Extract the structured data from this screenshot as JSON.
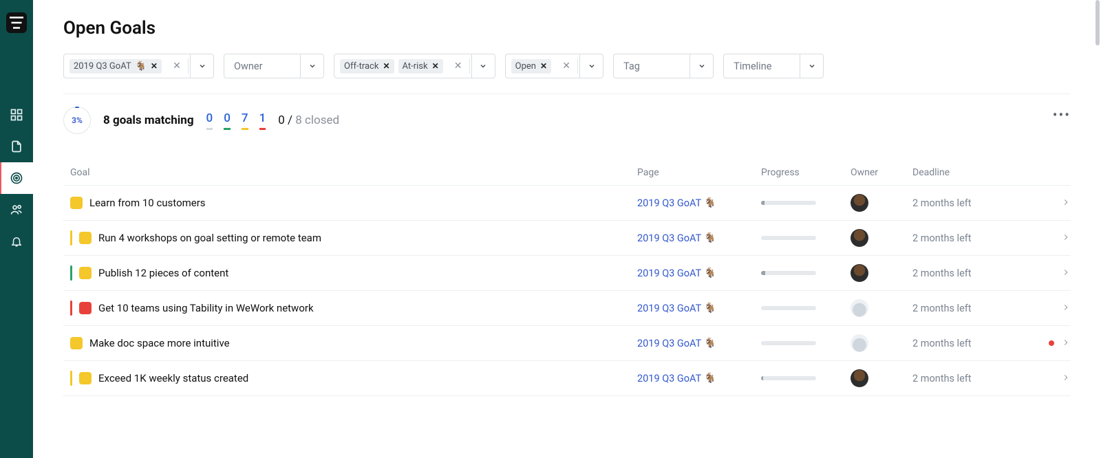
{
  "page": {
    "title": "Open Goals"
  },
  "sidebar": {
    "items": [
      {
        "name": "dashboard-icon"
      },
      {
        "name": "document-icon"
      },
      {
        "name": "target-icon",
        "active": true
      },
      {
        "name": "people-icon"
      },
      {
        "name": "bell-icon"
      }
    ]
  },
  "filters": {
    "goat": {
      "chips": [
        {
          "label": "2019 Q3 GoAT",
          "emoji": "🐐"
        }
      ]
    },
    "owner": {
      "placeholder": "Owner"
    },
    "health": {
      "chips": [
        {
          "label": "Off-track"
        },
        {
          "label": "At-risk"
        }
      ]
    },
    "status": {
      "chips": [
        {
          "label": "Open"
        }
      ]
    },
    "tag": {
      "placeholder": "Tag"
    },
    "timeline": {
      "placeholder": "Timeline"
    }
  },
  "summary": {
    "pct": "3%",
    "match_label": "8 goals matching",
    "counts": {
      "none": "0",
      "green": "0",
      "yellow": "7",
      "red": "1",
      "open_closed_prefix": "0",
      "open_closed_sep": " / ",
      "closed": "8 closed"
    }
  },
  "columns": {
    "goal": "Goal",
    "page": "Page",
    "progress": "Progress",
    "owner": "Owner",
    "deadline": "Deadline"
  },
  "page_ref": {
    "label": "2019 Q3 GoAT",
    "emoji": "🐐"
  },
  "rows": [
    {
      "stripe": "none",
      "square": "yellow",
      "title": "Learn from 10 customers",
      "progress": 6,
      "avatar": "a",
      "deadline": "2 months left",
      "flag": false
    },
    {
      "stripe": "yellow",
      "square": "yellow",
      "title": "Run 4 workshops on goal setting or remote team",
      "progress": 0,
      "avatar": "a",
      "deadline": "2 months left",
      "flag": false
    },
    {
      "stripe": "green",
      "square": "yellow",
      "title": "Publish 12 pieces of content",
      "progress": 8,
      "avatar": "a",
      "deadline": "2 months left",
      "flag": false
    },
    {
      "stripe": "red",
      "square": "red",
      "title": "Get 10 teams using Tability in WeWork network",
      "progress": 0,
      "avatar": "b",
      "deadline": "2 months left",
      "flag": false
    },
    {
      "stripe": "none",
      "square": "yellow",
      "title": "Make doc space more intuitive",
      "progress": 0,
      "avatar": "b",
      "deadline": "2 months left",
      "flag": true
    },
    {
      "stripe": "yellow",
      "square": "yellow",
      "title": "Exceed 1K weekly status created",
      "progress": 4,
      "avatar": "a",
      "deadline": "2 months left",
      "flag": false
    }
  ]
}
